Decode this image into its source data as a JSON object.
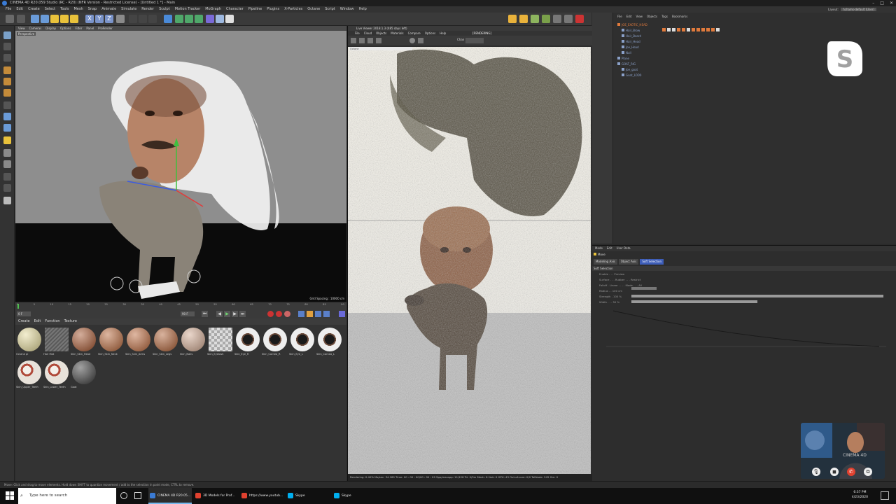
{
  "window": {
    "title": "CINEMA 4D R20.059 Studio (RC - R20) (NFR Version - Restricted License) - [Untitled 1 *] - Main",
    "controls": [
      "–",
      "□",
      "✕"
    ]
  },
  "menubar": [
    "File",
    "Edit",
    "Create",
    "Select",
    "Tools",
    "Mesh",
    "Snap",
    "Animate",
    "Simulate",
    "Render",
    "Sculpt",
    "Motion Tracker",
    "MoGraph",
    "Character",
    "Pipeline",
    "Plugins",
    "X-Particles",
    "Octane",
    "Script",
    "Window",
    "Help"
  ],
  "layout": {
    "label": "Layout:",
    "value": "hchams-default (User)"
  },
  "viewport": {
    "menu": [
      "View",
      "Cameras",
      "Display",
      "Options",
      "Filter",
      "Panel",
      "ProRender"
    ],
    "label": "Perspective",
    "grid_spacing": "Grid Spacing : 10000 cm"
  },
  "timeline": {
    "ticks": [
      "0",
      "5",
      "10",
      "15",
      "20",
      "25",
      "30",
      "35",
      "40",
      "45",
      "50",
      "55",
      "60",
      "65",
      "70",
      "75",
      "80",
      "85",
      "90"
    ],
    "start": "0 F",
    "end": "90 F"
  },
  "materials": {
    "menu": [
      "Create",
      "Edit",
      "Function",
      "Texture"
    ],
    "items": [
      {
        "label": "Octane pl",
        "color": "#e8dfa8"
      },
      {
        "label": "Hair Mat",
        "color": "#6f6f6f"
      },
      {
        "label": "Skin_Skin_Head",
        "color": "#b06a48"
      },
      {
        "label": "Skin_Skin_Neck",
        "color": "#c07a52"
      },
      {
        "label": "Skin_Skin_Arms",
        "color": "#c47c55"
      },
      {
        "label": "Skin_Skin_Legs",
        "color": "#b9744e"
      },
      {
        "label": "Skin_Nails",
        "color": "#d8b5a0"
      },
      {
        "label": "Skin_Eyelash",
        "color": "#cccccc"
      },
      {
        "label": "Skin_Eye_R",
        "color": "#e8e8e8"
      },
      {
        "label": "Skin_Cornea_R",
        "color": "#e8e8e8"
      },
      {
        "label": "Skin_Eye_L",
        "color": "#e8e8e8"
      },
      {
        "label": "Skin_Cornea_L",
        "color": "#e8e8e8"
      },
      {
        "label": "Skin_Upper_Teeth",
        "color": "#d6a48c"
      },
      {
        "label": "Skin_Lower_Teeth",
        "color": "#d6a48c"
      },
      {
        "label": "Goat",
        "color": "#555555"
      }
    ]
  },
  "render_view": {
    "title": "Live Viewer 2018.1.3 (485 days left)",
    "menu": [
      "File",
      "Cloud",
      "Objects",
      "Materials",
      "Compare",
      "Options",
      "Help"
    ],
    "state": "[RENDERING]",
    "channel_label": "Chan",
    "status": "Rendering: 0.40%   Ms/sec: 34.189   Time: 00 : 00 : 00/00 : 00 : 09   Spp/maxspp: 11/128   Tri: 0/3m   Mesh: 6   Hair: 0   GPU: 43   Out-of-core: 0/0   TotNode: 245   Gm: 0"
  },
  "object_manager": {
    "menu": [
      "File",
      "Edit",
      "View",
      "Objects",
      "Tags",
      "Bookmarks"
    ],
    "rows": [
      {
        "label": "JOE_EXOTIC_HEAD",
        "indent": 0,
        "color": "#e07a3c"
      },
      {
        "label": "Hair_Brow",
        "indent": 1,
        "color": "#8aa0c8"
      },
      {
        "label": "Hair_Beard",
        "indent": 1,
        "color": "#8aa0c8"
      },
      {
        "label": "Hair_Head",
        "indent": 1,
        "color": "#8aa0c8"
      },
      {
        "label": "Joe_Head",
        "indent": 1,
        "color": "#8aa0c8"
      },
      {
        "label": "Null",
        "indent": 1,
        "color": "#8aa0c8"
      },
      {
        "label": "Plane",
        "indent": 0,
        "color": "#8aa0c8"
      },
      {
        "label": "GOAT_RIG",
        "indent": 0,
        "color": "#8aa0c8"
      },
      {
        "label": "Joe_goat",
        "indent": 1,
        "color": "#8aa0c8"
      },
      {
        "label": "Goat_LOD0",
        "indent": 1,
        "color": "#8aa0c8"
      }
    ]
  },
  "attribute_manager": {
    "menu": [
      "Mode",
      "Edit",
      "User Data"
    ],
    "object": "Move",
    "tabs": [
      "Modeling Axis",
      "Object Axis",
      "Soft Selection"
    ],
    "active_tab": 2,
    "section": "Soft Selection",
    "rows": [
      "Enable . . . Preview",
      "Surface . . . Rubber . . . Restrict",
      "Falloff . Linear . . . . Mode . . . All",
      "Radius . . 100 cm",
      "Strength . 100 %",
      "Width . . . 50 %"
    ]
  },
  "statusline": "Move: Click and drag to move elements. Hold down SHIFT to quantize movement / add to the selection in point mode, CTRL to remove.",
  "taskbar": {
    "search_placeholder": "Type here to search",
    "tasks": [
      {
        "label": "CINEMA 4D R20.05...",
        "color": "#3a7bd5",
        "active": true
      },
      {
        "label": "3D Models for Prof...",
        "color": "#e0412f",
        "active": false
      },
      {
        "label": "https://www.youtub...",
        "color": "#e0412f",
        "active": false
      },
      {
        "label": "Skype",
        "color": "#00aff0",
        "active": false
      },
      {
        "label": "Skype",
        "color": "#00aff0",
        "active": false
      }
    ],
    "time": "6:37 PM",
    "date": "4/23/2020"
  },
  "video_call": {
    "caption": "CINEMA 4D"
  }
}
